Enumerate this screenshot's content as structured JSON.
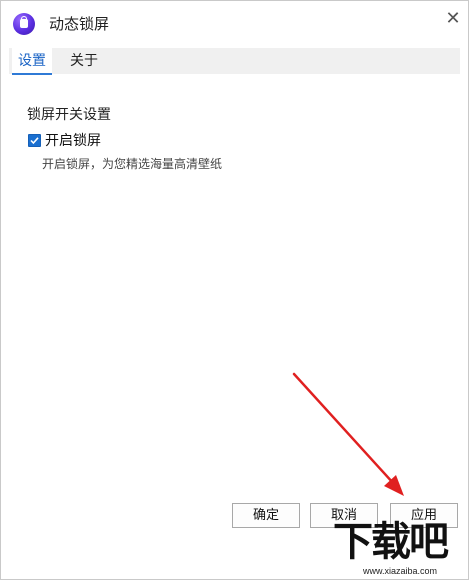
{
  "window": {
    "title": "动态锁屏",
    "close_glyph": "✕"
  },
  "tabs": [
    {
      "label": "设置",
      "active": true
    },
    {
      "label": "关于",
      "active": false
    }
  ],
  "settings": {
    "section_title": "锁屏开关设置",
    "lock_screen_checkbox": {
      "label": "开启锁屏",
      "checked": true
    },
    "description": "开启锁屏，为您精选海量高清壁纸"
  },
  "buttons": {
    "ok": "确定",
    "cancel": "取消",
    "apply": "应用"
  },
  "annotation": {
    "arrow_color": "#e02020"
  },
  "watermark": {
    "logo": "下载吧",
    "url": "www.xiazaiba.com"
  },
  "colors": {
    "accent": "#2f7ad6",
    "checkbox": "#1a6fd0"
  }
}
